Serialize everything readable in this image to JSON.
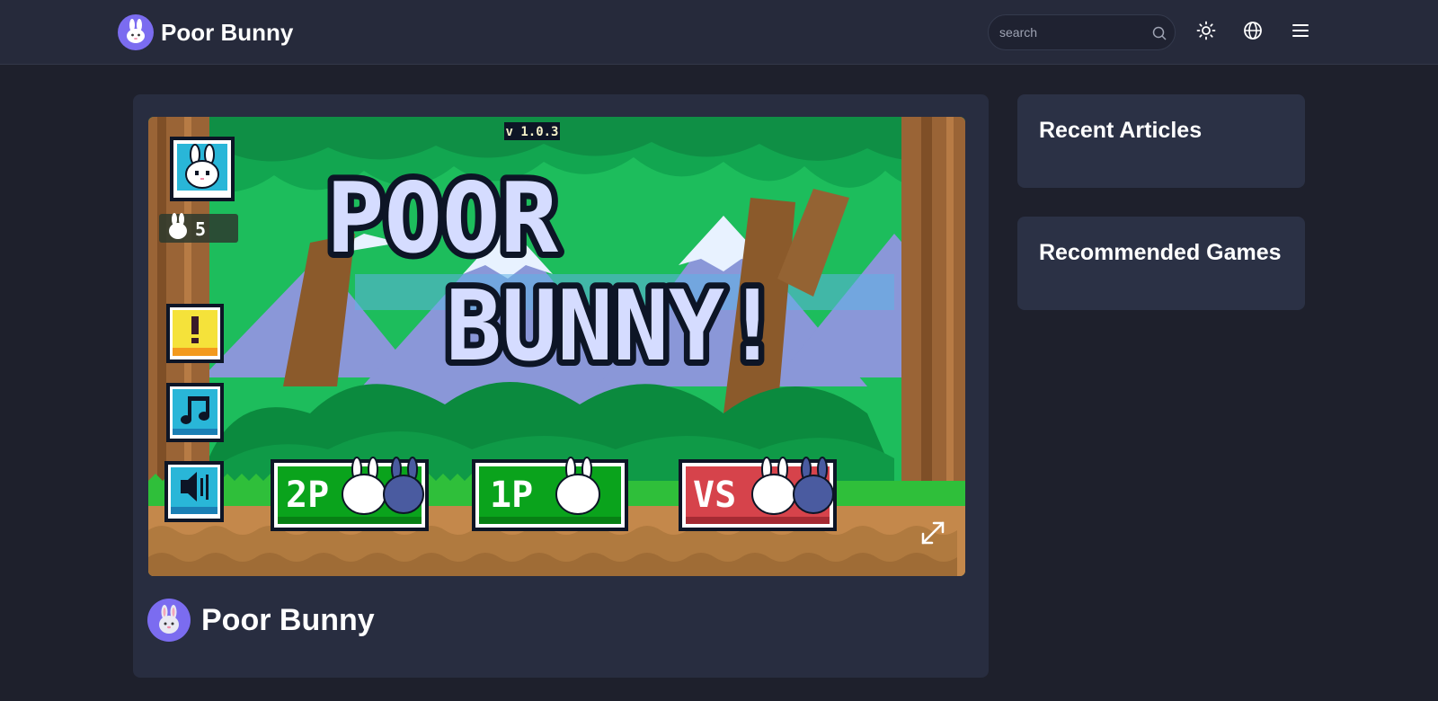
{
  "header": {
    "brand_name": "Poor Bunny",
    "logo_icon": "bunny-icon",
    "search": {
      "placeholder": "search",
      "value": ""
    },
    "icons": [
      "search-icon",
      "sun-icon",
      "globe-icon",
      "menu-icon"
    ]
  },
  "game": {
    "title": "Poor Bunny",
    "version": "v 1.0.3",
    "logo_line1": "POOR",
    "logo_line2": "BUNNY!",
    "lives": "5",
    "mode_buttons": {
      "two_player": "2P",
      "one_player": "1P",
      "versus": "VS"
    },
    "side_icons": [
      "bunny-character-icon",
      "alert-icon",
      "music-icon",
      "sound-icon"
    ],
    "fullscreen_icon": "expand-icon"
  },
  "sidebar": {
    "recent_title": "Recent Articles",
    "recommended_title": "Recommended Games"
  },
  "colors": {
    "page_bg": "#1e202c",
    "header_bg": "#262a3b",
    "card_bg": "#282d40",
    "accent": "#7b6cf0",
    "game_green": "#0aa31c",
    "game_red": "#d6434b",
    "sky": "#1dbd5c"
  }
}
